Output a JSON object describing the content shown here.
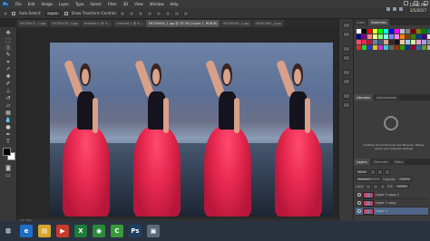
{
  "menu": {
    "logo": "Ps",
    "items": [
      "File",
      "Edit",
      "Image",
      "Layer",
      "Type",
      "Select",
      "Filter",
      "3D",
      "View",
      "Window",
      "Help"
    ]
  },
  "options": {
    "auto_select_label": "Auto-Select:",
    "auto_select_value": "Layer",
    "show_transform_label": "Show Transform Controls"
  },
  "tabs": [
    {
      "label": "05750471_1.jpg",
      "active": false
    },
    {
      "label": "05750470_1.jpg",
      "active": false
    },
    {
      "label": "Untitled-1 @ 3...",
      "active": false
    },
    {
      "label": "Untitled-1 @ 6...",
      "active": false
    },
    {
      "label": "06750490_1.jpg @ 33.3% (Layer 1, RGB/8)",
      "active": true
    },
    {
      "label": "06750491_1.jpg",
      "active": false
    },
    {
      "label": "06750492_1.jpg",
      "active": false
    }
  ],
  "status": {
    "zoom": "33.33%"
  },
  "panels": {
    "color_tabs": [
      "Color",
      "Swatches"
    ],
    "library_tabs": [
      "Libraries",
      "Adjustments"
    ],
    "library_message": "Creative Cloud Services and libraries. Please check your Internet settings",
    "layers_tabs": [
      "Layers",
      "Channels",
      "Paths"
    ],
    "kind_label": "Kind",
    "blend_mode": "Normal",
    "opacity_label": "Opacity:",
    "opacity_value": "100%",
    "lock_label": "Lock:",
    "fill_label": "Fill:",
    "fill_value": "100%",
    "layers": [
      {
        "name": "Layer 1 copy 2",
        "selected": false
      },
      {
        "name": "Layer 1 copy",
        "selected": false
      },
      {
        "name": "Layer 1",
        "selected": true
      }
    ]
  },
  "swatch_colors": [
    "#ffffff",
    "#000000",
    "#ff0000",
    "#ffff00",
    "#00ff00",
    "#00ffff",
    "#0000ff",
    "#ff00ff",
    "#c0c0c0",
    "#808080",
    "#800000",
    "#808000",
    "#008000",
    "#008080",
    "#000080",
    "#800080",
    "#ff8080",
    "#ffff80",
    "#80ff80",
    "#80ffff",
    "#8080ff",
    "#ff80ff",
    "#ff8000",
    "#804000",
    "#408000",
    "#004080",
    "#400080",
    "#e0e0e0",
    "#ff4b6e",
    "#e8294f",
    "#b8163a",
    "#6d83a6",
    "#46576f",
    "#d9a48c",
    "#3a2422",
    "#15131d",
    "#f0c8a0",
    "#a0c8f0",
    "#c8f0a0",
    "#f0a0c8",
    "#a0a0f0",
    "#909090",
    "#cc3333",
    "#33cc33",
    "#3333cc",
    "#cccc33",
    "#cc33cc",
    "#33cccc",
    "#666666",
    "#993300",
    "#339900",
    "#003399",
    "#990033",
    "#336699",
    "#669933",
    "#b0b0b0"
  ],
  "taskbar": {
    "clock_time": "12:52 PM",
    "clock_date": "2/5/2017",
    "apps": [
      {
        "name": "windows-start",
        "glyph": "⊞",
        "color": "#2a3340"
      },
      {
        "name": "ie",
        "glyph": "e",
        "color": "#1e6fc8"
      },
      {
        "name": "explorer",
        "glyph": "▤",
        "color": "#d6a52a"
      },
      {
        "name": "media",
        "glyph": "▶",
        "color": "#c83a2a"
      },
      {
        "name": "excel",
        "glyph": "X",
        "color": "#1e7a3a"
      },
      {
        "name": "chrome",
        "glyph": "◉",
        "color": "#2a8a3a"
      },
      {
        "name": "camtasia",
        "glyph": "C",
        "color": "#3a9a3a"
      },
      {
        "name": "photoshop",
        "glyph": "Ps",
        "color": "#1f3f63"
      },
      {
        "name": "folder",
        "glyph": "▣",
        "color": "#5a6a7a"
      }
    ]
  }
}
